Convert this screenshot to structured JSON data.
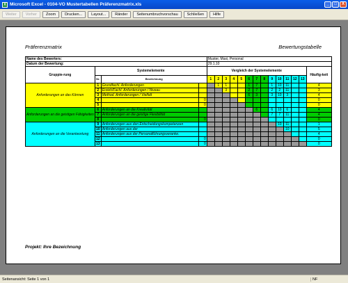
{
  "window": {
    "title": "Microsoft Excel - 0104-VO Mustertabellen Präferenzmatrix.xls",
    "min": "_",
    "max": "□",
    "close": "X"
  },
  "toolbar": [
    {
      "label": "Weiter",
      "enabled": false
    },
    {
      "label": "Vorher",
      "enabled": false
    },
    {
      "label": "Zoom",
      "enabled": true
    },
    {
      "label": "Drucken...",
      "enabled": true
    },
    {
      "label": "Layout...",
      "enabled": true
    },
    {
      "label": "Ränder",
      "enabled": true
    },
    {
      "label": "Seitenumbruchvorschau",
      "enabled": true
    },
    {
      "label": "Schließen",
      "enabled": true
    },
    {
      "label": "Hilfe",
      "enabled": true
    }
  ],
  "page": {
    "header_left": "Präferenzmatrix",
    "header_right": "Bewertungstabelle",
    "footer": "Projekt: Ihre Bezeichnung"
  },
  "sheet": {
    "bewerter_label": "Name des Bewerters:",
    "bewerter_value": "Muster, Maxi, Personal",
    "datum_label": "Datum der Bewertung:",
    "datum_value": "29.1.10",
    "gruppierung": "Gruppie-rung",
    "systemelemente": "Systemelemente",
    "vergleich": "Vergleich der Systemelemente",
    "haeufigkeit": "Häufig-keit",
    "nr": "Nr.",
    "bezeichnung": "Bezeichnung",
    "col_numbers": [
      "1",
      "2",
      "3",
      "4",
      "5",
      "6",
      "7",
      "8",
      "9",
      "10",
      "11",
      "12",
      "13"
    ],
    "col_colors": [
      "y",
      "y",
      "y",
      "y",
      "y",
      "g",
      "g",
      "g",
      "c",
      "c",
      "c",
      "c",
      "c"
    ],
    "groups": [
      {
        "label": "Anforderungen an das Können",
        "color": "y",
        "start": 0,
        "span": 5
      },
      {
        "label": "Anforderungen an die geistigen Fähigkeiten",
        "color": "g",
        "start": 5,
        "span": 3
      },
      {
        "label": "Anforderungen an die Verantwortung",
        "color": "c",
        "start": 8,
        "span": 5
      }
    ],
    "rows": [
      {
        "nr": "1",
        "name": "Grundfachl. Anforderungen",
        "zero": "",
        "color": "y",
        "cells": [
          "",
          "1",
          "1",
          "",
          "",
          "1",
          "7",
          "",
          "1",
          "10",
          "11",
          "",
          ""
        ],
        "freq": "4"
      },
      {
        "nr": "2",
        "name": "Erzieh/Fachl. Anforderungen / Niveau",
        "zero": "",
        "color": "y",
        "cells": [
          "",
          "",
          "3",
          "",
          "",
          "2",
          "7",
          "",
          "2",
          "2",
          "11",
          "",
          ""
        ],
        "freq": "3"
      },
      {
        "nr": "3",
        "name": "Method. Anforderungen / Vielfalt",
        "zero": "",
        "color": "y",
        "cells": [
          "",
          "",
          "",
          "",
          "",
          "6",
          "3",
          "",
          "3",
          "10",
          "3",
          "",
          ""
        ],
        "freq": "4"
      },
      {
        "nr": "4",
        "name": "",
        "zero": "0",
        "color": "y",
        "cells": [
          "",
          "",
          "",
          "",
          "",
          "",
          "",
          "",
          "",
          "",
          "",
          "",
          ""
        ],
        "freq": "0"
      },
      {
        "nr": "5",
        "name": "",
        "zero": "0",
        "color": "y",
        "cells": [
          "",
          "",
          "",
          "",
          "",
          "",
          "",
          "",
          "",
          "",
          "",
          "",
          ""
        ],
        "freq": "0"
      },
      {
        "nr": "6",
        "name": "Anforderungen an die Kreativität",
        "zero": "",
        "color": "g",
        "cells": [
          "",
          "",
          "",
          "",
          "",
          "",
          "6",
          "",
          "6",
          "10",
          "6",
          "",
          ""
        ],
        "freq": "4"
      },
      {
        "nr": "7",
        "name": "Anforderungen an die geistige Flexibilität",
        "zero": "",
        "color": "g",
        "cells": [
          "",
          "",
          "",
          "",
          "",
          "",
          "",
          "",
          "7",
          "7",
          "11",
          "",
          ""
        ],
        "freq": "4"
      },
      {
        "nr": "8",
        "name": "",
        "zero": "0",
        "color": "g",
        "cells": [
          "",
          "",
          "",
          "",
          "",
          "",
          "",
          "",
          "",
          "",
          "",
          "",
          ""
        ],
        "freq": "0"
      },
      {
        "nr": "9",
        "name": "Anforderungen aus den Entscheidungskompetenzen",
        "zero": "",
        "color": "c",
        "cells": [
          "",
          "",
          "",
          "",
          "",
          "",
          "",
          "",
          "",
          "10",
          "11",
          "",
          ""
        ],
        "freq": "1"
      },
      {
        "nr": "10",
        "name": "Anforderungen aus der",
        "zero": "",
        "color": "c",
        "cells": [
          "",
          "",
          "",
          "",
          "",
          "",
          "",
          "",
          "",
          "",
          "10",
          "",
          ""
        ],
        "freq": "5"
      },
      {
        "nr": "11",
        "name": "Anforderungen aus der Personalführungsverantw.",
        "zero": "",
        "color": "c",
        "cells": [
          "",
          "",
          "",
          "",
          "",
          "",
          "",
          "",
          "",
          "",
          "",
          "",
          ""
        ],
        "freq": "4"
      },
      {
        "nr": "12",
        "name": "",
        "zero": "0",
        "color": "c",
        "cells": [
          "",
          "",
          "",
          "",
          "",
          "",
          "",
          "",
          "",
          "",
          "",
          "",
          ""
        ],
        "freq": "0"
      },
      {
        "nr": "13",
        "name": "",
        "zero": "0",
        "color": "c",
        "cells": [
          "",
          "",
          "",
          "",
          "",
          "",
          "",
          "",
          "",
          "",
          "",
          "",
          ""
        ],
        "freq": "0"
      }
    ]
  },
  "status": {
    "left": "Seitenansicht: Seite 1 von 1",
    "nf": "NF"
  }
}
